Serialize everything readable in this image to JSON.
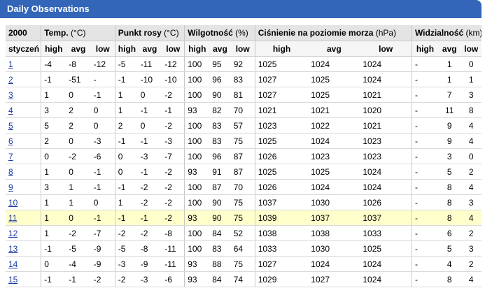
{
  "title": "Daily Observations",
  "year": "2000",
  "groups": {
    "temp": {
      "name": "Temp.",
      "unit": "(°C)"
    },
    "dew": {
      "name": "Punkt rosy",
      "unit": "(°C)"
    },
    "hum": {
      "name": "Wilgotność",
      "unit": "(%)"
    },
    "press": {
      "name": "Ciśnienie na poziomie morza",
      "unit": "(hPa)"
    },
    "vis": {
      "name": "Widzialność",
      "unit": "(km)"
    }
  },
  "month": "styczeń",
  "sub": {
    "high": "high",
    "avg": "avg",
    "low": "low"
  },
  "highlight_row": 10,
  "rows": [
    {
      "day": "1",
      "t": [
        "-4",
        "-8",
        "-12"
      ],
      "d": [
        "-5",
        "-11",
        "-12"
      ],
      "h": [
        "100",
        "95",
        "92"
      ],
      "p": [
        "1025",
        "1024",
        "1024"
      ],
      "v": [
        "-",
        "1",
        "0"
      ]
    },
    {
      "day": "2",
      "t": [
        "-1",
        "-51",
        "-"
      ],
      "d": [
        "-1",
        "-10",
        "-10"
      ],
      "h": [
        "100",
        "96",
        "83"
      ],
      "p": [
        "1027",
        "1025",
        "1024"
      ],
      "v": [
        "-",
        "1",
        "1"
      ]
    },
    {
      "day": "3",
      "t": [
        "1",
        "0",
        "-1"
      ],
      "d": [
        "1",
        "0",
        "-2"
      ],
      "h": [
        "100",
        "90",
        "81"
      ],
      "p": [
        "1027",
        "1025",
        "1021"
      ],
      "v": [
        "-",
        "7",
        "3"
      ]
    },
    {
      "day": "4",
      "t": [
        "3",
        "2",
        "0"
      ],
      "d": [
        "1",
        "-1",
        "-1"
      ],
      "h": [
        "93",
        "82",
        "70"
      ],
      "p": [
        "1021",
        "1021",
        "1020"
      ],
      "v": [
        "-",
        "11",
        "8"
      ]
    },
    {
      "day": "5",
      "t": [
        "5",
        "2",
        "0"
      ],
      "d": [
        "2",
        "0",
        "-2"
      ],
      "h": [
        "100",
        "83",
        "57"
      ],
      "p": [
        "1023",
        "1022",
        "1021"
      ],
      "v": [
        "-",
        "9",
        "4"
      ]
    },
    {
      "day": "6",
      "t": [
        "2",
        "0",
        "-3"
      ],
      "d": [
        "-1",
        "-1",
        "-3"
      ],
      "h": [
        "100",
        "83",
        "75"
      ],
      "p": [
        "1025",
        "1024",
        "1023"
      ],
      "v": [
        "-",
        "9",
        "4"
      ]
    },
    {
      "day": "7",
      "t": [
        "0",
        "-2",
        "-6"
      ],
      "d": [
        "0",
        "-3",
        "-7"
      ],
      "h": [
        "100",
        "96",
        "87"
      ],
      "p": [
        "1026",
        "1023",
        "1023"
      ],
      "v": [
        "-",
        "3",
        "0"
      ]
    },
    {
      "day": "8",
      "t": [
        "1",
        "0",
        "-1"
      ],
      "d": [
        "0",
        "-1",
        "-2"
      ],
      "h": [
        "93",
        "91",
        "87"
      ],
      "p": [
        "1025",
        "1025",
        "1024"
      ],
      "v": [
        "-",
        "5",
        "2"
      ]
    },
    {
      "day": "9",
      "t": [
        "3",
        "1",
        "-1"
      ],
      "d": [
        "-1",
        "-2",
        "-2"
      ],
      "h": [
        "100",
        "87",
        "70"
      ],
      "p": [
        "1026",
        "1024",
        "1024"
      ],
      "v": [
        "-",
        "8",
        "4"
      ]
    },
    {
      "day": "10",
      "t": [
        "1",
        "1",
        "0"
      ],
      "d": [
        "1",
        "-2",
        "-2"
      ],
      "h": [
        "100",
        "90",
        "75"
      ],
      "p": [
        "1037",
        "1030",
        "1026"
      ],
      "v": [
        "-",
        "8",
        "3"
      ]
    },
    {
      "day": "11",
      "t": [
        "1",
        "0",
        "-1"
      ],
      "d": [
        "-1",
        "-1",
        "-2"
      ],
      "h": [
        "93",
        "90",
        "75"
      ],
      "p": [
        "1039",
        "1037",
        "1037"
      ],
      "v": [
        "-",
        "8",
        "4"
      ]
    },
    {
      "day": "12",
      "t": [
        "1",
        "-2",
        "-7"
      ],
      "d": [
        "-2",
        "-2",
        "-8"
      ],
      "h": [
        "100",
        "84",
        "52"
      ],
      "p": [
        "1038",
        "1038",
        "1033"
      ],
      "v": [
        "-",
        "6",
        "2"
      ]
    },
    {
      "day": "13",
      "t": [
        "-1",
        "-5",
        "-9"
      ],
      "d": [
        "-5",
        "-8",
        "-11"
      ],
      "h": [
        "100",
        "83",
        "64"
      ],
      "p": [
        "1033",
        "1030",
        "1025"
      ],
      "v": [
        "-",
        "5",
        "3"
      ]
    },
    {
      "day": "14",
      "t": [
        "0",
        "-4",
        "-9"
      ],
      "d": [
        "-3",
        "-9",
        "-11"
      ],
      "h": [
        "93",
        "88",
        "75"
      ],
      "p": [
        "1027",
        "1024",
        "1024"
      ],
      "v": [
        "-",
        "4",
        "2"
      ]
    },
    {
      "day": "15",
      "t": [
        "-1",
        "-1",
        "-2"
      ],
      "d": [
        "-2",
        "-3",
        "-6"
      ],
      "h": [
        "93",
        "84",
        "74"
      ],
      "p": [
        "1029",
        "1027",
        "1024"
      ],
      "v": [
        "-",
        "8",
        "4"
      ]
    }
  ]
}
